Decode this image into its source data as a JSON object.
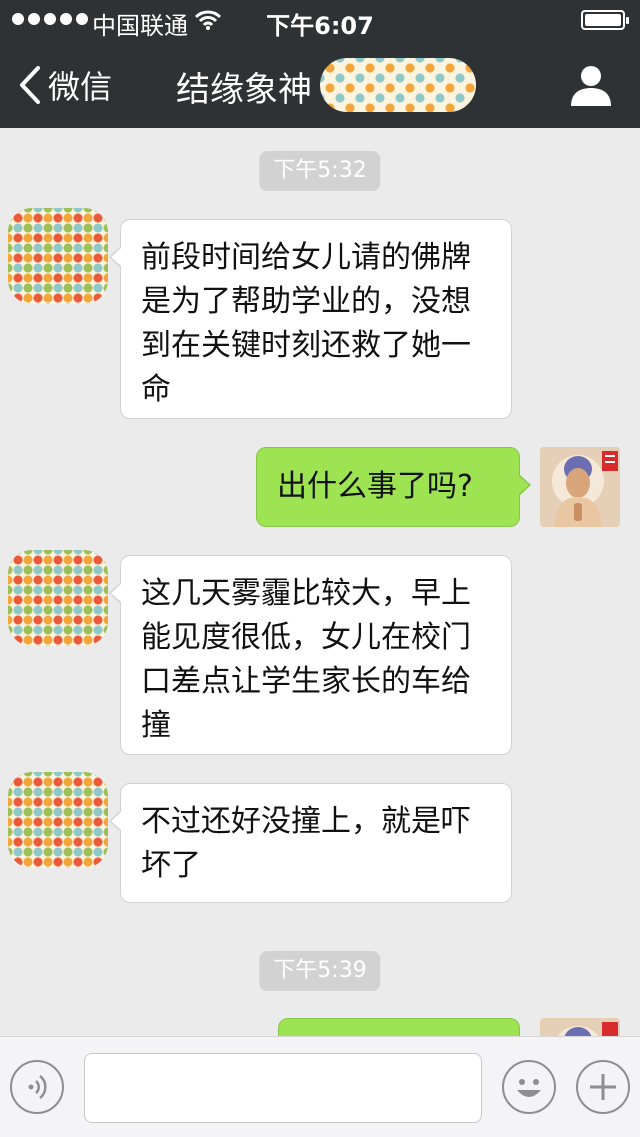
{
  "status_bar": {
    "carrier": "中国联通",
    "time": "下午6:07"
  },
  "nav": {
    "back_label": "微信",
    "title": "结缘象神"
  },
  "messages": [
    {
      "type": "time",
      "text": "下午5:32"
    },
    {
      "type": "incoming",
      "text": "前段时间给女儿请的佛牌是为了帮助学业的，没想到在关键时刻还救了她一命"
    },
    {
      "type": "outgoing",
      "text": "出什么事了吗?"
    },
    {
      "type": "incoming",
      "text": "这几天雾霾比较大，早上能见度很低，女儿在校门口差点让学生家长的车给撞"
    },
    {
      "type": "incoming",
      "text": "不过还好没撞上，就是吓坏了"
    },
    {
      "type": "time",
      "text": "下午5:39"
    }
  ],
  "icons": {
    "back": "chevron-left-icon",
    "profile": "person-icon",
    "voice": "voice-icon",
    "emoji": "smiley-icon",
    "more": "plus-icon"
  },
  "colors": {
    "nav_background": "#2f3234",
    "chat_background": "#ebebeb",
    "outgoing_bubble": "#9de352",
    "incoming_bubble": "#ffffff",
    "time_pill": "#d2d2d2"
  }
}
